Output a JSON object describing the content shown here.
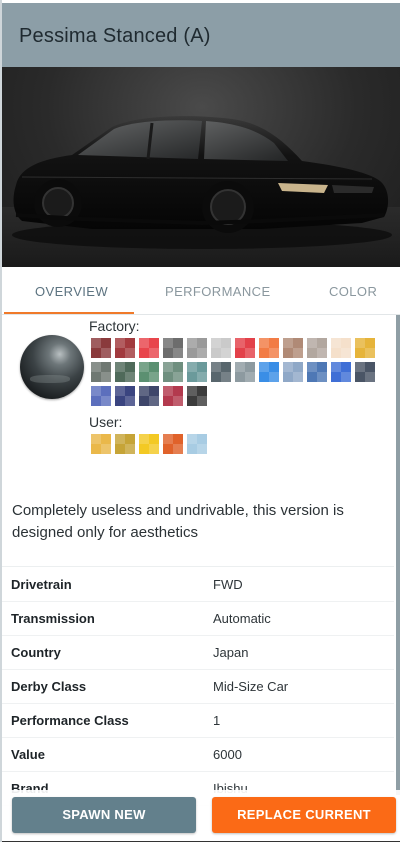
{
  "header": {
    "title": "Pessima Stanced (A)"
  },
  "tabs": [
    {
      "label": "OVERVIEW",
      "active": true
    },
    {
      "label": "PERFORMANCE",
      "active": false
    },
    {
      "label": "COLOR",
      "active": false
    }
  ],
  "colors": {
    "factory_label": "Factory:",
    "user_label": "User:",
    "factory": [
      "#8a3a3c",
      "#a23a3e",
      "#e8454c",
      "#6d6d6d",
      "#9a9a9a",
      "#cacaca",
      "#e3414a",
      "#f27c45",
      "#b08a76",
      "#b2a79f",
      "#f5e0cb",
      "#e6b43a",
      "#6f7872",
      "#4f6a5a",
      "#5b9071",
      "#6f8f7f",
      "#6b9a9b",
      "#58666d",
      "#8d9aa0",
      "#3a8ee6",
      "#8fa8c7",
      "#4e78b5",
      "#3f6fd6",
      "#4a5566",
      "#5c6fbd",
      "#3a4480",
      "#3e466a",
      "#b33a4e",
      "#3c3c3c",
      "#ffffff"
    ],
    "user": [
      "#eab84a",
      "#c6a437",
      "#f3c924",
      "#e0622a",
      "#a8cce3"
    ]
  },
  "description": "Completely useless and undrivable, this version is designed only for aesthetics",
  "specs": [
    {
      "label": "Drivetrain",
      "value": "FWD"
    },
    {
      "label": "Transmission",
      "value": "Automatic"
    },
    {
      "label": "Country",
      "value": "Japan"
    },
    {
      "label": "Derby Class",
      "value": "Mid-Size Car"
    },
    {
      "label": "Performance Class",
      "value": "1"
    },
    {
      "label": "Value",
      "value": "6000"
    },
    {
      "label": "Brand",
      "value": "Ibishu"
    }
  ],
  "buttons": {
    "spawn": "SPAWN NEW",
    "replace": "REPLACE CURRENT"
  }
}
